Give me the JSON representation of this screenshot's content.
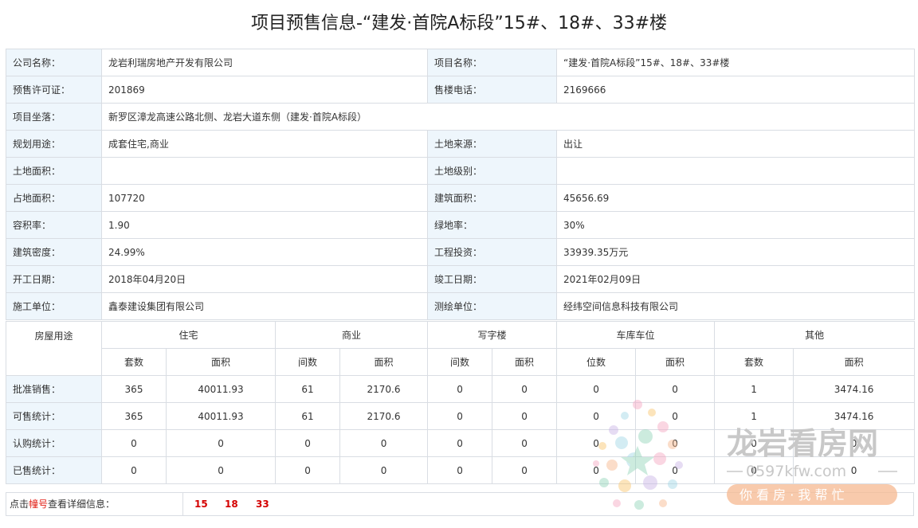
{
  "title": "项目预售信息-“建发·首院A标段”15#、18#、33#楼",
  "info": {
    "rows": [
      {
        "l1": "公司名称：",
        "v1": "龙岩利瑞房地产开发有限公司",
        "l2": "项目名称：",
        "v2": "“建发·首院A标段”15#、18#、33#楼"
      },
      {
        "l1": "预售许可证：",
        "v1": "201869",
        "l2": "售楼电话：",
        "v2": "2169666"
      },
      {
        "l1": "项目坐落：",
        "v1": "新罗区漳龙高速公路北侧、龙岩大道东侧（建发·首院A标段）"
      },
      {
        "l1": "规划用途：",
        "v1": "成套住宅,商业",
        "l2": "土地来源：",
        "v2": "出让"
      },
      {
        "l1": "土地面积：",
        "v1": "",
        "l2": "土地级别：",
        "v2": ""
      },
      {
        "l1": "占地面积：",
        "v1": "107720",
        "l2": "建筑面积：",
        "v2": "45656.69"
      },
      {
        "l1": "容积率：",
        "v1": "1.90",
        "l2": "绿地率：",
        "v2": "30%"
      },
      {
        "l1": "建筑密度：",
        "v1": "24.99%",
        "l2": "工程投资：",
        "v2": "33939.35万元"
      },
      {
        "l1": "开工日期：",
        "v1": "2018年04月20日",
        "l2": "竣工日期：",
        "v2": "2021年02月09日"
      },
      {
        "l1": "施工单位：",
        "v1": "鑫泰建设集团有限公司",
        "l2": "测绘单位：",
        "v2": "经纬空间信息科技有限公司"
      }
    ]
  },
  "stats": {
    "corner": "房屋用途",
    "groups": [
      "住宅",
      "商业",
      "写字楼",
      "车库车位",
      "其他"
    ],
    "subheaders": [
      "套数",
      "面积",
      "间数",
      "面积",
      "间数",
      "面积",
      "位数",
      "面积",
      "套数",
      "面积"
    ],
    "rows": [
      {
        "label": "批准销售：",
        "values": [
          "365",
          "40011.93",
          "61",
          "2170.6",
          "0",
          "0",
          "0",
          "0",
          "1",
          "3474.16"
        ]
      },
      {
        "label": "可售统计：",
        "values": [
          "365",
          "40011.93",
          "61",
          "2170.6",
          "0",
          "0",
          "0",
          "0",
          "1",
          "3474.16"
        ]
      },
      {
        "label": "认购统计：",
        "values": [
          "0",
          "0",
          "0",
          "0",
          "0",
          "0",
          "0",
          "0",
          "0",
          "0"
        ]
      },
      {
        "label": "已售统计：",
        "values": [
          "0",
          "0",
          "0",
          "0",
          "0",
          "0",
          "0",
          "0",
          "0",
          "0"
        ]
      }
    ]
  },
  "footer": {
    "prefix": "点击",
    "highlight": "幢号",
    "suffix": "查看详细信息：",
    "buildings": [
      "15",
      "18",
      "33"
    ]
  },
  "watermark": {
    "brand": "龙岩看房网",
    "domain": "0597kfw.com",
    "slogan": "你 看 房 · 我 帮 忙"
  }
}
